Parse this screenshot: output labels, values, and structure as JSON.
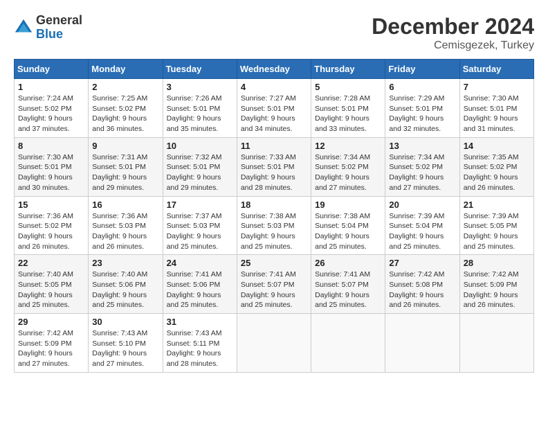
{
  "header": {
    "logo_line1": "General",
    "logo_line2": "Blue",
    "month_year": "December 2024",
    "location": "Cemisgezek, Turkey"
  },
  "weekdays": [
    "Sunday",
    "Monday",
    "Tuesday",
    "Wednesday",
    "Thursday",
    "Friday",
    "Saturday"
  ],
  "weeks": [
    [
      {
        "day": "1",
        "sunrise": "7:24 AM",
        "sunset": "5:02 PM",
        "daylight": "9 hours and 37 minutes."
      },
      {
        "day": "2",
        "sunrise": "7:25 AM",
        "sunset": "5:02 PM",
        "daylight": "9 hours and 36 minutes."
      },
      {
        "day": "3",
        "sunrise": "7:26 AM",
        "sunset": "5:01 PM",
        "daylight": "9 hours and 35 minutes."
      },
      {
        "day": "4",
        "sunrise": "7:27 AM",
        "sunset": "5:01 PM",
        "daylight": "9 hours and 34 minutes."
      },
      {
        "day": "5",
        "sunrise": "7:28 AM",
        "sunset": "5:01 PM",
        "daylight": "9 hours and 33 minutes."
      },
      {
        "day": "6",
        "sunrise": "7:29 AM",
        "sunset": "5:01 PM",
        "daylight": "9 hours and 32 minutes."
      },
      {
        "day": "7",
        "sunrise": "7:30 AM",
        "sunset": "5:01 PM",
        "daylight": "9 hours and 31 minutes."
      }
    ],
    [
      {
        "day": "8",
        "sunrise": "7:30 AM",
        "sunset": "5:01 PM",
        "daylight": "9 hours and 30 minutes."
      },
      {
        "day": "9",
        "sunrise": "7:31 AM",
        "sunset": "5:01 PM",
        "daylight": "9 hours and 29 minutes."
      },
      {
        "day": "10",
        "sunrise": "7:32 AM",
        "sunset": "5:01 PM",
        "daylight": "9 hours and 29 minutes."
      },
      {
        "day": "11",
        "sunrise": "7:33 AM",
        "sunset": "5:01 PM",
        "daylight": "9 hours and 28 minutes."
      },
      {
        "day": "12",
        "sunrise": "7:34 AM",
        "sunset": "5:02 PM",
        "daylight": "9 hours and 27 minutes."
      },
      {
        "day": "13",
        "sunrise": "7:34 AM",
        "sunset": "5:02 PM",
        "daylight": "9 hours and 27 minutes."
      },
      {
        "day": "14",
        "sunrise": "7:35 AM",
        "sunset": "5:02 PM",
        "daylight": "9 hours and 26 minutes."
      }
    ],
    [
      {
        "day": "15",
        "sunrise": "7:36 AM",
        "sunset": "5:02 PM",
        "daylight": "9 hours and 26 minutes."
      },
      {
        "day": "16",
        "sunrise": "7:36 AM",
        "sunset": "5:03 PM",
        "daylight": "9 hours and 26 minutes."
      },
      {
        "day": "17",
        "sunrise": "7:37 AM",
        "sunset": "5:03 PM",
        "daylight": "9 hours and 25 minutes."
      },
      {
        "day": "18",
        "sunrise": "7:38 AM",
        "sunset": "5:03 PM",
        "daylight": "9 hours and 25 minutes."
      },
      {
        "day": "19",
        "sunrise": "7:38 AM",
        "sunset": "5:04 PM",
        "daylight": "9 hours and 25 minutes."
      },
      {
        "day": "20",
        "sunrise": "7:39 AM",
        "sunset": "5:04 PM",
        "daylight": "9 hours and 25 minutes."
      },
      {
        "day": "21",
        "sunrise": "7:39 AM",
        "sunset": "5:05 PM",
        "daylight": "9 hours and 25 minutes."
      }
    ],
    [
      {
        "day": "22",
        "sunrise": "7:40 AM",
        "sunset": "5:05 PM",
        "daylight": "9 hours and 25 minutes."
      },
      {
        "day": "23",
        "sunrise": "7:40 AM",
        "sunset": "5:06 PM",
        "daylight": "9 hours and 25 minutes."
      },
      {
        "day": "24",
        "sunrise": "7:41 AM",
        "sunset": "5:06 PM",
        "daylight": "9 hours and 25 minutes."
      },
      {
        "day": "25",
        "sunrise": "7:41 AM",
        "sunset": "5:07 PM",
        "daylight": "9 hours and 25 minutes."
      },
      {
        "day": "26",
        "sunrise": "7:41 AM",
        "sunset": "5:07 PM",
        "daylight": "9 hours and 25 minutes."
      },
      {
        "day": "27",
        "sunrise": "7:42 AM",
        "sunset": "5:08 PM",
        "daylight": "9 hours and 26 minutes."
      },
      {
        "day": "28",
        "sunrise": "7:42 AM",
        "sunset": "5:09 PM",
        "daylight": "9 hours and 26 minutes."
      }
    ],
    [
      {
        "day": "29",
        "sunrise": "7:42 AM",
        "sunset": "5:09 PM",
        "daylight": "9 hours and 27 minutes."
      },
      {
        "day": "30",
        "sunrise": "7:43 AM",
        "sunset": "5:10 PM",
        "daylight": "9 hours and 27 minutes."
      },
      {
        "day": "31",
        "sunrise": "7:43 AM",
        "sunset": "5:11 PM",
        "daylight": "9 hours and 28 minutes."
      },
      null,
      null,
      null,
      null
    ]
  ]
}
